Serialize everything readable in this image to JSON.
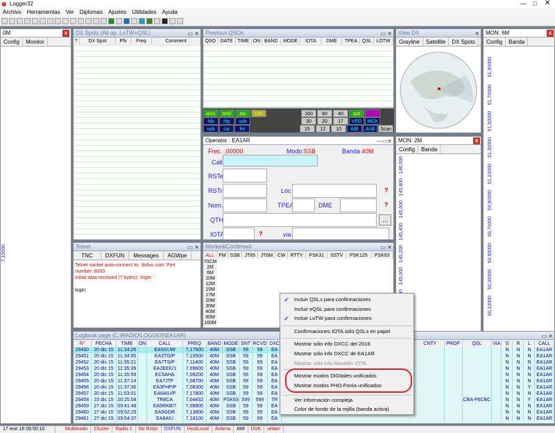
{
  "app": {
    "title": "Logger32",
    "menu": [
      "Archivo",
      "Herramientas",
      "Ver",
      "Diplomas",
      "Ajustes",
      "Utilidades",
      "Ayuda"
    ]
  },
  "left_panel": {
    "title": "0M",
    "tabs": [
      "Config",
      "Monitor"
    ],
    "scale": "7,10000"
  },
  "dxspots": {
    "title": "DX Spots (All op. LoTW+QSL)",
    "cols": [
      "?",
      "DX Spot",
      "Pfx",
      "Freq",
      "Comment"
    ]
  },
  "prevqso": {
    "title": "Previous QSOs",
    "cols": [
      "QSO",
      "DATE",
      "TIME",
      "ON",
      "BAND",
      "MODE",
      "IOTA",
      "DME",
      "TPEA",
      "QSL",
      "LOTW"
    ]
  },
  "viewdx": {
    "title": "View DX",
    "tabs": [
      "Grayline",
      "Satellite",
      "DX Spots"
    ]
  },
  "mon6m": {
    "title": "MON: 6M",
    "tabs": [
      "Config",
      "Banda"
    ],
    "scale": [
      "51,90000",
      "51,70000",
      "51,50000",
      "51,30000",
      "51,10000",
      "50,90000",
      "50,70000",
      "50,50000",
      "50,30000",
      "50,10000"
    ]
  },
  "mon2m": {
    "title": "MON: 2M",
    "tabs": [
      "Config",
      "Banda"
    ],
    "scale": [
      "146,000",
      "145,800",
      "145,600",
      "145,400",
      "145,200",
      "145,000",
      "144,800"
    ]
  },
  "keypad": {
    "row1": [
      "ant1",
      "ant2",
      "dw",
      "DW",
      "160",
      "80",
      "40",
      "splt",
      "..."
    ],
    "row2": [
      "lsb",
      "rtty",
      "usb",
      "30",
      "20",
      "17",
      "VFO",
      "MCh"
    ],
    "row3": [
      "usb",
      "cw",
      "fm",
      "15",
      "12",
      "10",
      "A/B",
      "A=B",
      "Scan"
    ]
  },
  "operator": {
    "title": "Operator : EA1AR",
    "frec_label": "Frec.",
    "frec_value": ",00000",
    "modo_label": "Modo",
    "modo_value": "SSB",
    "banda_label": "Banda",
    "banda_value": "40M",
    "call": "Call",
    "rste": "RSTe",
    "rstr": "RSTr",
    "loc": "Loc",
    "nom": "Nom.",
    "tpea": "TPEA",
    "dme": "DME",
    "qth": "QTH",
    "iota": "IOTA",
    "via": "via",
    "q": "?",
    "dots": "..."
  },
  "telnet": {
    "title": "Telnet",
    "tabs": [
      "TNC",
      "DXFUN",
      "Messages",
      "AGWpe"
    ],
    "lines": [
      "Telnet socket auto-connect to: 'dxfun.com' Port",
      "number: 8000",
      "Initial data received (7 bytes): 'login: '",
      "",
      "login:"
    ]
  },
  "worked": {
    "title": "Worked/Confirmed",
    "cols": [
      "ALL",
      "FM",
      "SSB",
      "JT65",
      "JT6M",
      "CW",
      "RTTY",
      "PSK31",
      "SSTV",
      "PSK125",
      "PSK63"
    ],
    "bands": [
      "70CM",
      "2M",
      "6M",
      "10M",
      "12M",
      "15M",
      "17M",
      "20M",
      "30M",
      "40M",
      "80M",
      "160M"
    ]
  },
  "logbook": {
    "title": "Logbook page (C:\\RADIO\\LOGGER\\EA1AR)",
    "cols": [
      "Nº",
      "FECHA",
      "TIME",
      "ON",
      "CALL",
      "FREQ",
      "BAND",
      "MODE",
      "SNT",
      "RCVD",
      "DXC"
    ],
    "cols_right": [
      "CNTY",
      "PROP",
      "QSL",
      "VIA",
      "S",
      "R",
      "L",
      "CALL"
    ],
    "rows": [
      [
        "29450",
        "20 dic 15",
        "11:34:26",
        "EA5GUW",
        "7,17500",
        "40M",
        "SSB",
        "59",
        "59",
        "EA"
      ],
      [
        "29451",
        "20 dic 15",
        "11:34:55",
        "EA3TO/P",
        "7,15500",
        "40M",
        "SSB",
        "59",
        "59",
        "EA"
      ],
      [
        "29452",
        "20 dic 15",
        "11:35:21",
        "EA7TS/P",
        "7,11400",
        "40M",
        "SSB",
        "59",
        "59",
        "EA"
      ],
      [
        "29453",
        "20 dic 15",
        "11:35:39",
        "EA2EEK/1",
        "7,09600",
        "40M",
        "SSB",
        "59",
        "59",
        "EA"
      ],
      [
        "29454",
        "20 dic 15",
        "11:35:59",
        "EC5AHA",
        "7,09200",
        "40M",
        "SSB",
        "59",
        "59",
        "EA"
      ],
      [
        "29455",
        "20 dic 15",
        "11:37:14",
        "EA7JTF",
        "7,08700",
        "40M",
        "SSB",
        "59",
        "59",
        "EA"
      ],
      [
        "29456",
        "20 dic 15",
        "11:37:36",
        "EA3FHP/P",
        "7,08300",
        "40M",
        "SSB",
        "59",
        "59",
        "EA"
      ],
      [
        "29457",
        "20 dic 15",
        "11:53:01",
        "EA6AIU/P",
        "7,17800",
        "40M",
        "SSB",
        "59",
        "59",
        "EA"
      ],
      [
        "29458",
        "23 dic 15",
        "20:25:58",
        "TR8CA",
        "7,04432",
        "40M",
        "PSK63",
        "599",
        "599",
        "TR"
      ],
      [
        "29459",
        "27 dic 15",
        "09:41:48",
        "EA5RKB/7",
        "7,09900",
        "40M",
        "SSB",
        "59",
        "59",
        "EA"
      ],
      [
        "29460",
        "27 dic 15",
        "09:52:29",
        "EA5GOR",
        "7,13800",
        "40M",
        "SSB",
        "59",
        "59",
        "EA"
      ],
      [
        "29461",
        "27 dic 15",
        "09:54:37",
        "EA6AIU",
        "7,18100",
        "40M",
        "SSB",
        "59",
        "59",
        "EA"
      ]
    ],
    "right_rows": [
      [
        "",
        "",
        "",
        "",
        "N",
        "N",
        "N",
        "EA1AR"
      ],
      [
        "",
        "",
        "",
        "",
        "N",
        "N",
        "N",
        "EA1AR"
      ],
      [
        "",
        "",
        "",
        "",
        "N",
        "N",
        "N",
        "EA1AR"
      ],
      [
        "",
        "",
        "",
        "",
        "N",
        "N",
        "N",
        "EA1AR"
      ],
      [
        "",
        "",
        "",
        "",
        "N",
        "N",
        "N",
        "EA1AR"
      ],
      [
        "",
        "",
        "",
        "",
        "N",
        "N",
        "N",
        "EA1AR"
      ],
      [
        "",
        "",
        "",
        "",
        "N",
        "N",
        "Y",
        "EA1AR"
      ],
      [
        "",
        "",
        "",
        "",
        "N",
        "N",
        "N",
        "EA1AR"
      ],
      [
        "",
        "",
        "CBA-F6CBC",
        "",
        "N",
        "N",
        "Y",
        "EA1AR"
      ],
      [
        "",
        "",
        "",
        "",
        "N",
        "N",
        "N",
        "EA1AR"
      ],
      [
        "",
        "",
        "",
        "",
        "N",
        "N",
        "N",
        "EA1AR"
      ],
      [
        "",
        "",
        "",
        "",
        "N",
        "N",
        "N",
        "EA1AR"
      ]
    ]
  },
  "context_menu": {
    "items": [
      "Incluir QSLs para confirmaciones",
      "Incluir eQSL para confirmaciones",
      "Incluir LoTW para confirmaciones",
      "Confirmaciones IOTA sólo QSLs en papel",
      "Mostrar sólo info DXCC del 2016",
      "Mostrar sólo info DXCC de EA1AR",
      "Mostrar sólo info Maratón IOTA",
      "Mostrar modos DIGitales unificados",
      "Mostrar modos PHO-Fonía unificados",
      "Ver información compleja",
      "Color de fondo de la rejilla (banda activa)"
    ],
    "checked": [
      true,
      false,
      true,
      false,
      false,
      false,
      false,
      false,
      false,
      false,
      false
    ],
    "disabled": [
      false,
      false,
      false,
      false,
      false,
      false,
      true,
      false,
      false,
      false,
      false
    ]
  },
  "status": {
    "items": [
      "17 ene 16  09:50:10",
      "Multimodo",
      "Cluster",
      "Radio 1",
      "No Rotor",
      "DXFUN",
      "HostLocal",
      "Antena",
      "###",
      "DVK",
      "uHam"
    ]
  }
}
